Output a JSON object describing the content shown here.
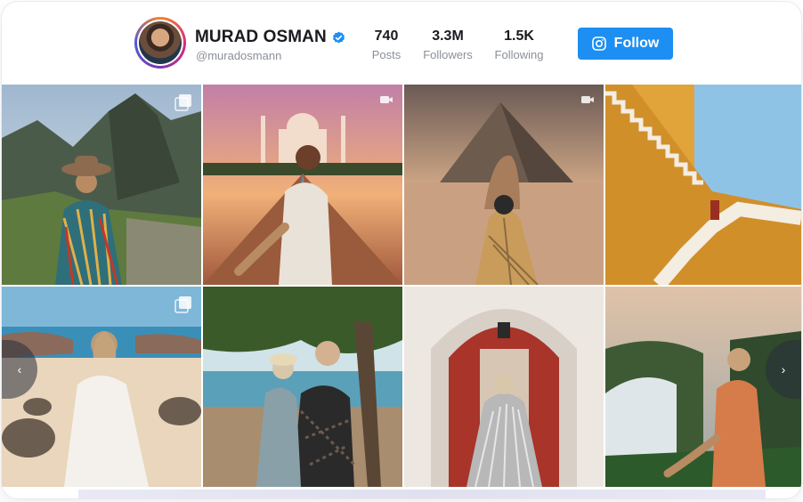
{
  "profile": {
    "name": "MURAD OSMAN",
    "handle": "@muradosmann",
    "verified": true
  },
  "stats": [
    {
      "value": "740",
      "label": "Posts"
    },
    {
      "value": "3.3M",
      "label": "Followers"
    },
    {
      "value": "1.5K",
      "label": "Following"
    }
  ],
  "follow_button": {
    "label": "Follow",
    "icon": "instagram-icon"
  },
  "colors": {
    "accent": "#1d8ff2",
    "verified": "#1d8ff2"
  },
  "navigation": {
    "prev_icon": "‹",
    "next_icon": "›"
  },
  "posts": [
    {
      "badge": "carousel-icon"
    },
    {
      "badge": "video-icon"
    },
    {
      "badge": "video-icon"
    },
    {
      "badge": ""
    },
    {
      "badge": "carousel-icon"
    },
    {
      "badge": ""
    },
    {
      "badge": ""
    },
    {
      "badge": ""
    }
  ]
}
